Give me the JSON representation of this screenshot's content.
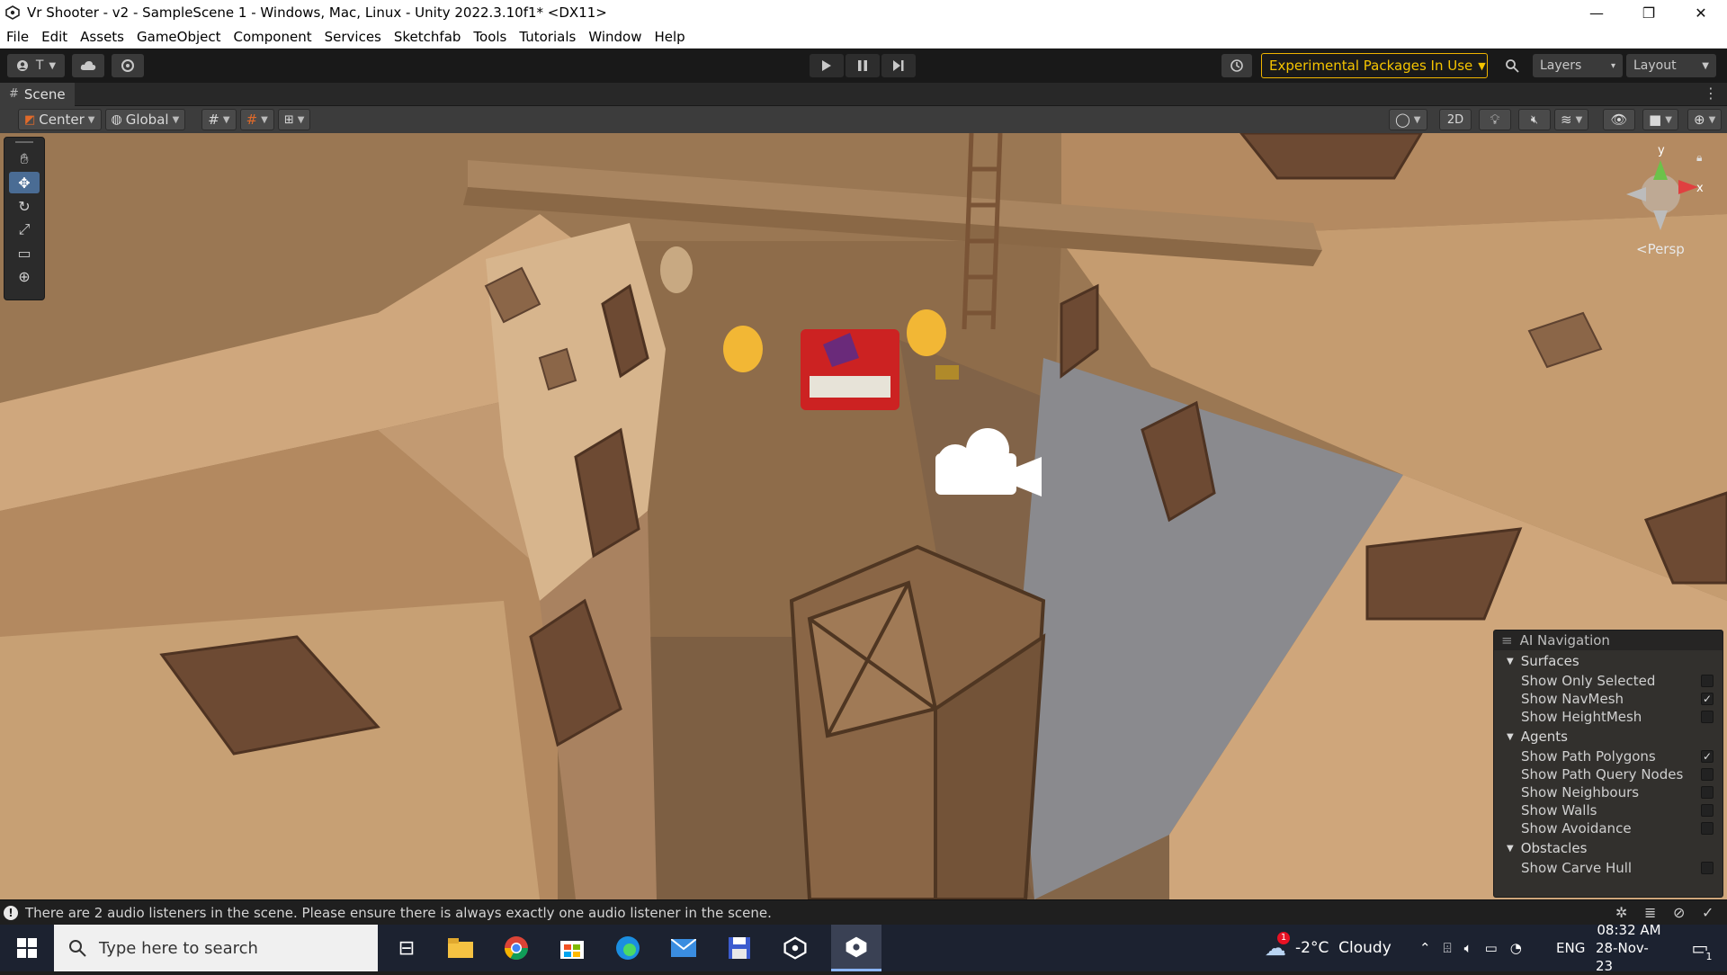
{
  "window": {
    "title": "Vr Shooter - v2 - SampleScene 1 - Windows, Mac, Linux - Unity 2022.3.10f1* <DX11>",
    "minimize": "—",
    "maximize": "❐",
    "close": "✕"
  },
  "menu": [
    "File",
    "Edit",
    "Assets",
    "GameObject",
    "Component",
    "Services",
    "Sketchfab",
    "Tools",
    "Tutorials",
    "Window",
    "Help"
  ],
  "toolbar": {
    "account_label": "T",
    "packages_label": "Experimental Packages In Use",
    "layers_label": "Layers",
    "layout_label": "Layout"
  },
  "scene_tab": {
    "label": "Scene"
  },
  "scene_toolbar": {
    "pivot_label": "Center",
    "space_label": "Global",
    "two_d_label": "2D"
  },
  "gizmo": {
    "axis_y": "y",
    "axis_x": "x",
    "persp_label": "<Persp"
  },
  "ai_navigation": {
    "title": "AI Navigation",
    "sections": [
      {
        "label": "Surfaces",
        "items": [
          {
            "label": "Show Only Selected",
            "checked": false
          },
          {
            "label": "Show NavMesh",
            "checked": true
          },
          {
            "label": "Show HeightMesh",
            "checked": false
          }
        ]
      },
      {
        "label": "Agents",
        "items": [
          {
            "label": "Show Path Polygons",
            "checked": true
          },
          {
            "label": "Show Path Query Nodes",
            "checked": false
          },
          {
            "label": "Show Neighbours",
            "checked": false
          },
          {
            "label": "Show Walls",
            "checked": false
          },
          {
            "label": "Show Avoidance",
            "checked": false
          }
        ]
      },
      {
        "label": "Obstacles",
        "items": [
          {
            "label": "Show Carve Hull",
            "checked": false
          }
        ]
      }
    ]
  },
  "status": {
    "message": "There are 2 audio listeners in the scene. Please ensure there is always exactly one audio listener in the scene."
  },
  "taskbar": {
    "search_placeholder": "Type here to search",
    "weather": "-2°C  Cloudy",
    "weather_badge": "1",
    "language": "ENG",
    "time": "08:32 AM",
    "date": "28-Nov-23",
    "notification_count": "1"
  },
  "colors": {
    "accent": "#4a6c94",
    "packages_border": "#f0b400",
    "taskbar": "#1c2230"
  }
}
